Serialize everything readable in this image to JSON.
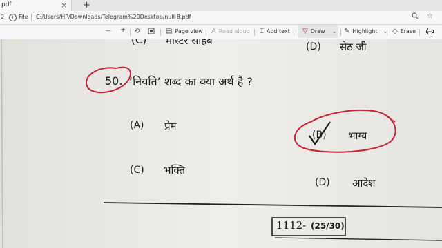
{
  "tab": {
    "title": "pdf",
    "close": "×",
    "new_tab": "+"
  },
  "address": {
    "page_indicator": "2",
    "file_label": "File",
    "url": "C:/Users/HP/Downloads/Telegram%20Desktop/null-8.pdf"
  },
  "toolbar": {
    "zoom_out": "—",
    "zoom_in": "+",
    "page_view": "Page view",
    "read_aloud": "Read aloud",
    "add_text": "Add text",
    "draw": "Draw",
    "highlight": "Highlight",
    "erase": "Erase"
  },
  "document": {
    "prev_option_c": "(C)",
    "prev_option_c_text": "मास्टर साहब",
    "prev_option_d": "(D)",
    "prev_option_d_text": "सेठ जी",
    "question_number": "50.",
    "question_text": "‘नियति’ शब्द का क्या अर्थ है ?",
    "options": [
      {
        "label": "(A)",
        "text": "प्रेम"
      },
      {
        "label": "(B)",
        "text": "भाग्य"
      },
      {
        "label": "(C)",
        "text": "भक्ति"
      },
      {
        "label": "(D)",
        "text": "आदेश"
      }
    ],
    "footer_code": "1112-",
    "footer_page": "(25/30)"
  },
  "colors": {
    "annotation_red": "#c8222e",
    "ink": "#1a1a1a"
  }
}
